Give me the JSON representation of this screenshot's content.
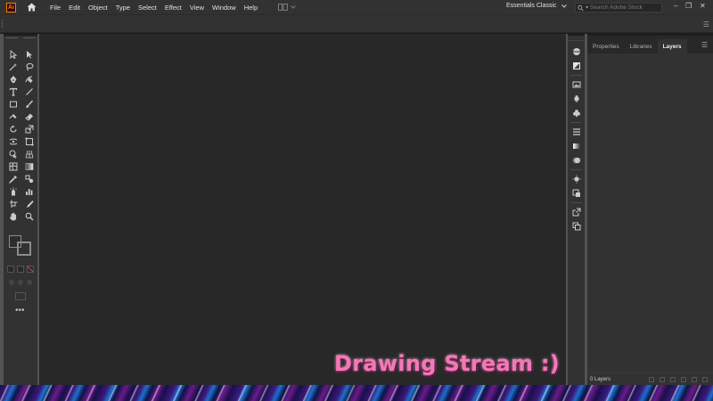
{
  "app": {
    "logo_text": "Ai",
    "logo_color": "#ff7c00"
  },
  "menu": {
    "items": [
      {
        "label": "File"
      },
      {
        "label": "Edit"
      },
      {
        "label": "Object"
      },
      {
        "label": "Type"
      },
      {
        "label": "Select"
      },
      {
        "label": "Effect"
      },
      {
        "label": "View"
      },
      {
        "label": "Window"
      },
      {
        "label": "Help"
      }
    ]
  },
  "workspace": {
    "label": "Essentials Classic"
  },
  "search": {
    "placeholder": "Search Adobe Stock"
  },
  "window_controls": {
    "minimize": "–",
    "maximize": "❐",
    "close": "✕"
  },
  "panel": {
    "tabs": [
      {
        "label": "Properties",
        "active": false
      },
      {
        "label": "Libraries",
        "active": false
      },
      {
        "label": "Layers",
        "active": true
      }
    ],
    "footer_count": "0 Layers"
  },
  "overlay": {
    "text": "Drawing Stream :)",
    "color": "#f07ab8"
  }
}
